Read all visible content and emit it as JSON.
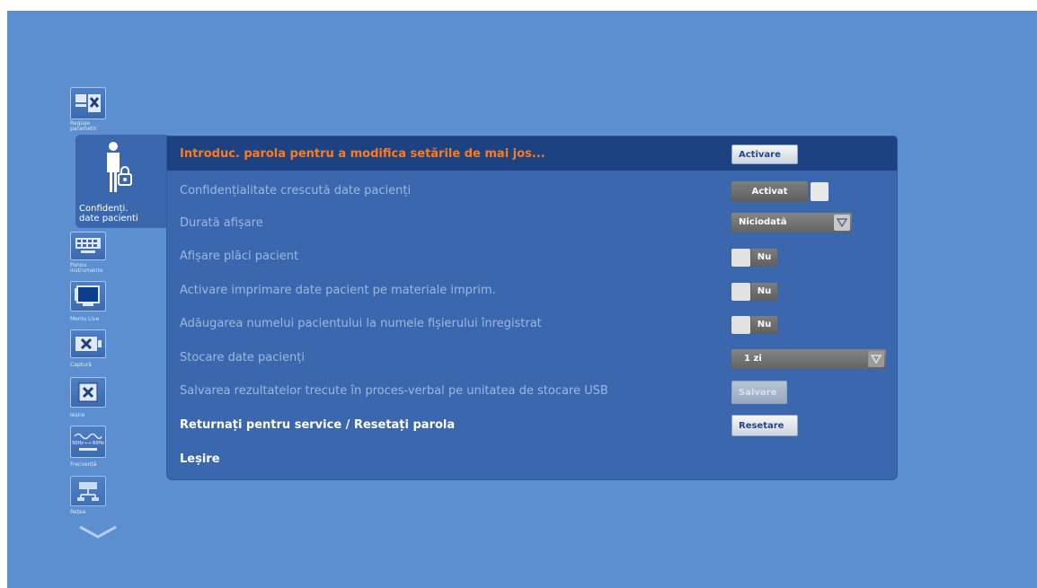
{
  "sidebar": {
    "items": [
      {
        "label": "Reglaje\nparametri"
      },
      {
        "label": "Confidenți.\ndate pacienti"
      },
      {
        "label": "Panou\ninstrumente"
      },
      {
        "label": "Meniu Live"
      },
      {
        "label": "Captură"
      },
      {
        "label": "Ieșire"
      },
      {
        "label": "Frecvență"
      },
      {
        "label": "Rețea"
      }
    ],
    "freq_icon_text": "50Hz ⟷ 60Hz"
  },
  "panel": {
    "header": {
      "label": "Introduc. parola pentru a modifica setările de mai jos...",
      "button": "Activare"
    },
    "rows": [
      {
        "label": "Confidențialitate crescută date pacienți",
        "value": "Activat"
      },
      {
        "label": "Durată afișare",
        "value": "Niciodată"
      },
      {
        "label": "Afișare plăci pacient",
        "value": "Nu"
      },
      {
        "label": "Activare imprimare date pacient pe materiale imprim.",
        "value": "Nu"
      },
      {
        "label": "Adăugarea numelui pacientului la numele fișierului înregistrat",
        "value": "Nu"
      },
      {
        "label": "Stocare date pacienți",
        "value": "1 zi"
      },
      {
        "label": "Salvarea rezultatelor trecute în proces-verbal pe unitatea de stocare USB",
        "value": "Salvare"
      },
      {
        "label": "Returnați pentru service / Resetați parola",
        "value": "Resetare"
      },
      {
        "label": "Leșire"
      }
    ]
  },
  "colors": {
    "background": "#5b8fcf",
    "panel": "#3a67ad",
    "header": "#1c4282",
    "accent": "#ff7a1a"
  }
}
